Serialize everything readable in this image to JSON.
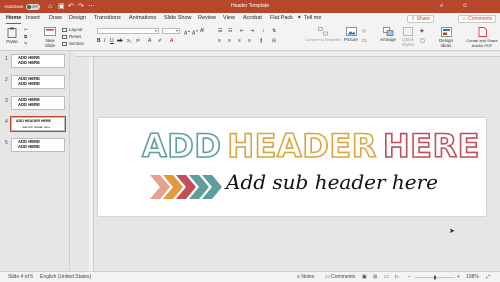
{
  "titlebar": {
    "autosave_label": "AutoSave",
    "autosave_state": "OFF",
    "title": "Header Template",
    "search_icon": "magnifier",
    "user_icon": "person"
  },
  "tabs": [
    "Home",
    "Insert",
    "Draw",
    "Design",
    "Transitions",
    "Animations",
    "Slide Show",
    "Review",
    "View",
    "Acrobat",
    "Flat Pack",
    "Tell me"
  ],
  "tab_actions": {
    "share": "Share",
    "comments": "Comments"
  },
  "ribbon": {
    "paste": "Paste",
    "new_slide": "New Slide",
    "layout": "Layout",
    "reset": "Reset",
    "section": "Section",
    "convert_smartart": "Convert to SmartArt",
    "picture": "Picture",
    "arrange": "Arrange",
    "quick_styles": "Quick Styles",
    "design_ideas": "Design Ideas",
    "create_pdf": "Create and Share Adobe PDF"
  },
  "slides": [
    {
      "num": "1",
      "line1": "ADD HERE",
      "line2": "ADD HERE"
    },
    {
      "num": "2",
      "line1": "ADD HERE",
      "line2": "ADD HERE"
    },
    {
      "num": "3",
      "line1": "ADD HERE",
      "line2": "ADD HERE"
    },
    {
      "num": "4",
      "line1": "ADD HEADER HERE",
      "line2": "Add sub header here"
    },
    {
      "num": "5",
      "line1": "ADD HERE",
      "line2": "ADD HERE"
    }
  ],
  "slide": {
    "header_words": [
      "ADD",
      "HEADER",
      "HERE"
    ],
    "sub": "Add sub header here",
    "colors": {
      "teal": "#5e9e9b",
      "yellow": "#d8a640",
      "red": "#c24e5a"
    }
  },
  "status": {
    "slide_count": "Slide 4 of 5",
    "language": "English (United States)",
    "notes": "Notes",
    "comments": "Comments",
    "zoom": "108%"
  }
}
